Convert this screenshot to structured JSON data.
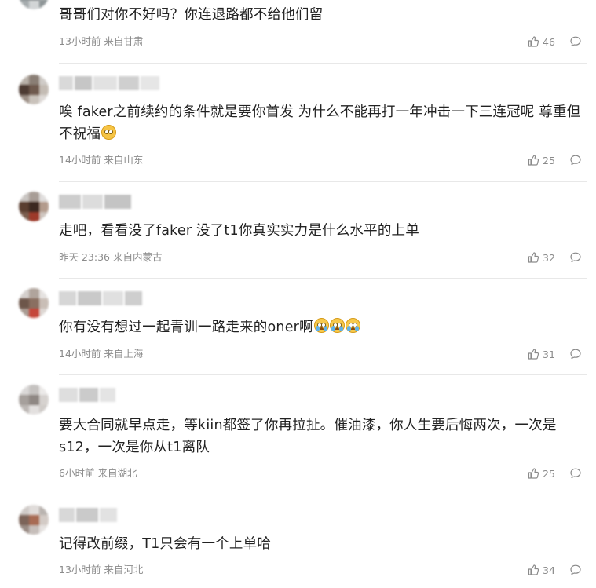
{
  "comments": [
    {
      "text": "哥哥们对你不好吗？你连退路都不给他们留",
      "time": "13小时前",
      "location": "来自甘肃",
      "likes": "46"
    },
    {
      "text": "唉 faker之前续约的条件就是要你首发 为什么不能再打一年冲击一下三连冠呢 尊重但不祝福",
      "time": "14小时前",
      "location": "来自山东",
      "likes": "25"
    },
    {
      "text": "走吧，看看没了faker 没了t1你真实实力是什么水平的上单",
      "time": "昨天 23:36",
      "location": "来自内蒙古",
      "likes": "32"
    },
    {
      "text": "你有没有想过一起青训一路走来的oner啊",
      "time": "14小时前",
      "location": "来自上海",
      "likes": "31"
    },
    {
      "text": "要大合同就早点走，等kiin都签了你再拉扯。催油漆，你人生要后悔两次，一次是s12，一次是你从t1离队",
      "time": "6小时前",
      "location": "来自湖北",
      "likes": "25"
    },
    {
      "text": "记得改前缀，T1只会有一个上单哈",
      "time": "13小时前",
      "location": "来自河北",
      "likes": "34"
    }
  ],
  "colors": {
    "text": "#222222",
    "meta": "#8b8b8b",
    "divider": "#e8e8e8",
    "emoji": "#f6c445"
  },
  "icons": {
    "like": "thumbs-up-icon",
    "reply": "comment-bubble-icon",
    "emoji_smile": "shy-face-emoji",
    "emoji_cry": "crying-face-emoji"
  }
}
